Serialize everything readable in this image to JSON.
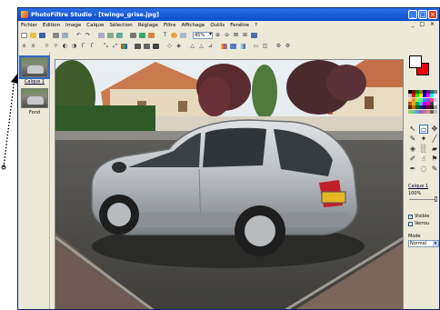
{
  "window": {
    "title": "PhotoFiltre Studio - [twingo_grise.jpg]"
  },
  "menu": [
    "Fichier",
    "Edition",
    "Image",
    "Calque",
    "Sélection",
    "Réglage",
    "Filtre",
    "Affichage",
    "Outils",
    "Fenêtre",
    "?"
  ],
  "toolbar": {
    "zoom": "45%"
  },
  "layers": [
    {
      "label": "Calque 1",
      "selected": true
    },
    {
      "label": "Fond",
      "selected": false
    }
  ],
  "right_panel": {
    "layer_name": "Calque 1",
    "opacity": "100%",
    "visible_label": "Visible",
    "visible_checked": "✓",
    "locked_label": "Verrou",
    "mode_label": "Mode",
    "mode_value": "Normal"
  },
  "colors": {
    "foreground": "#ffffff",
    "background": "#e8000e",
    "accent": "#316ac5"
  }
}
